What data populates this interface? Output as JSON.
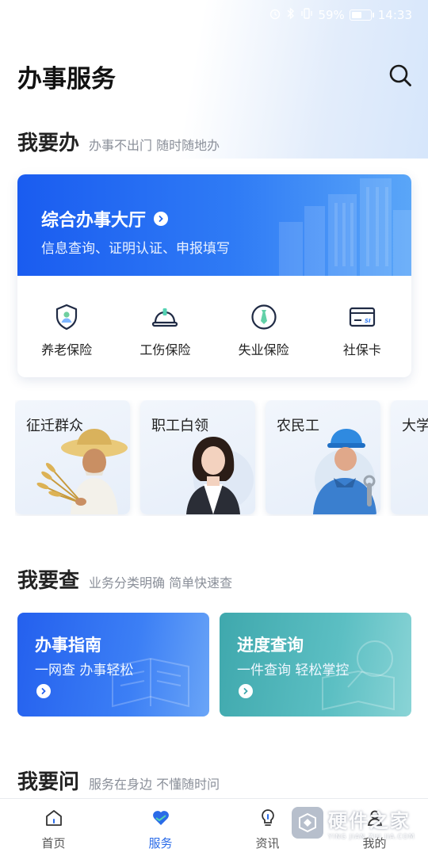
{
  "status_bar": {
    "battery": "59%",
    "time": "14:33"
  },
  "header": {
    "title": "办事服务"
  },
  "section_do": {
    "title": "我要办",
    "subtitle": "办事不出门 随时随地办"
  },
  "hall": {
    "title": "综合办事大厅",
    "subtitle": "信息查询、证明认证、申报填写",
    "items": [
      {
        "label": "养老保险",
        "icon": "shield-person-icon"
      },
      {
        "label": "工伤保险",
        "icon": "hard-hat-icon"
      },
      {
        "label": "失业保险",
        "icon": "tie-badge-icon"
      },
      {
        "label": "社保卡",
        "icon": "si-card-icon"
      }
    ]
  },
  "groups": [
    {
      "label": "征迁群众"
    },
    {
      "label": "职工白领"
    },
    {
      "label": "农民工"
    },
    {
      "label": "大学"
    }
  ],
  "section_check": {
    "title": "我要查",
    "subtitle": "业务分类明确 简单快速查"
  },
  "check_cards": [
    {
      "title": "办事指南",
      "subtitle": "一网查 办事轻松",
      "color": "#2a66ee"
    },
    {
      "title": "进度查询",
      "subtitle": "一件查询 轻松掌控",
      "color": "#49b4b9"
    }
  ],
  "section_ask": {
    "title": "我要问",
    "subtitle": "服务在身边 不懂随时问"
  },
  "tabs": [
    {
      "label": "首页",
      "icon": "home-icon"
    },
    {
      "label": "服务",
      "icon": "heart-icon"
    },
    {
      "label": "资讯",
      "icon": "lightbulb-icon"
    },
    {
      "label": "我的",
      "icon": "person-icon"
    }
  ],
  "colors": {
    "accent": "#2a6be8",
    "banner_start": "#1a5cf0",
    "banner_end": "#5aa6f8"
  },
  "watermark": {
    "main": "硬件之家",
    "sub": "YING JIAN ZHI JIA.COM"
  }
}
